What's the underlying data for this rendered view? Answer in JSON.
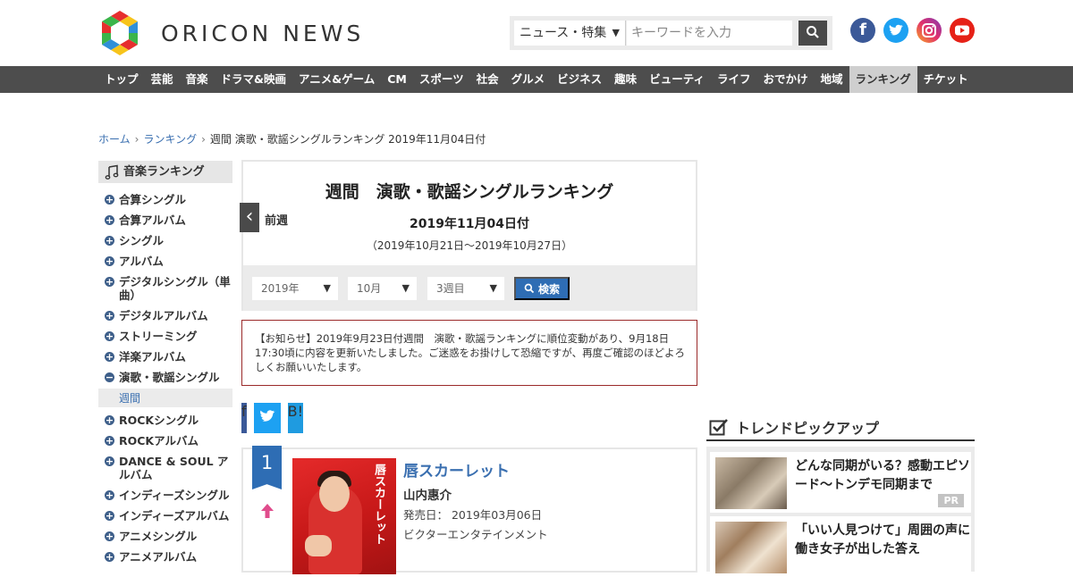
{
  "header": {
    "logo_text": "ORICON NEWS",
    "search": {
      "category": "ニュース・特集",
      "placeholder": "キーワードを入力"
    },
    "sns": [
      "facebook-icon",
      "twitter-icon",
      "instagram-icon",
      "youtube-icon"
    ]
  },
  "nav": {
    "items": [
      "トップ",
      "芸能",
      "音楽",
      "ドラマ&映画",
      "アニメ&ゲーム",
      "CM",
      "スポーツ",
      "社会",
      "グルメ",
      "ビジネス",
      "趣味",
      "ビューティ",
      "ライフ",
      "おでかけ",
      "地域",
      "ランキング",
      "チケット"
    ],
    "active": "ランキング"
  },
  "breadcrumb": {
    "home": "ホーム",
    "ranking": "ランキング",
    "current": "週間 演歌・歌謡シングルランキング 2019年11月04日付"
  },
  "sidebar": {
    "title": "音楽ランキング",
    "items": [
      {
        "label": "合算シングル",
        "mark": "+"
      },
      {
        "label": "合算アルバム",
        "mark": "+"
      },
      {
        "label": "シングル",
        "mark": "+"
      },
      {
        "label": "アルバム",
        "mark": "+"
      },
      {
        "label": "デジタルシングル（単曲）",
        "mark": "+"
      },
      {
        "label": "デジタルアルバム",
        "mark": "+"
      },
      {
        "label": "ストリーミング",
        "mark": "+"
      },
      {
        "label": "洋楽アルバム",
        "mark": "+"
      },
      {
        "label": "演歌・歌謡シングル",
        "mark": "−"
      },
      {
        "label": "週間",
        "mark": ""
      },
      {
        "label": "ROCKシングル",
        "mark": "+"
      },
      {
        "label": "ROCKアルバム",
        "mark": "+"
      },
      {
        "label": "DANCE & SOUL アルバム",
        "mark": "+"
      },
      {
        "label": "インディーズシングル",
        "mark": "+"
      },
      {
        "label": "インディーズアルバム",
        "mark": "+"
      },
      {
        "label": "アニメシングル",
        "mark": "+"
      },
      {
        "label": "アニメアルバム",
        "mark": "+"
      }
    ]
  },
  "ranking": {
    "title": "週間　演歌・歌謡シングルランキング",
    "prev_label": "前週",
    "date": "2019年11月04日付",
    "range": "（2019年10月21日～2019年10月27日）",
    "filters": {
      "year": "2019年",
      "month": "10月",
      "week": "3週目",
      "search_label": "検索"
    },
    "notice": "【お知らせ】2019年9月23日付週間　演歌・歌謡ランキングに順位変動があり、9月18日17:30頃に内容を更新いたしました。ご迷惑をお掛けして恐縮ですが、再度ご確認のほどよろしくお願いいたします。"
  },
  "share": {
    "facebook": "f",
    "twitter": "t",
    "hatena": "B!"
  },
  "entry": {
    "rank": "1",
    "trend_icon": "arrow-up-icon",
    "title": "唇スカーレット",
    "artist": "山内惠介",
    "release": "発売日：  2019年03月06日",
    "label": "ビクターエンタテインメント",
    "jacket_text": "唇スカーレット"
  },
  "trend": {
    "title": "トレンドピックアップ",
    "items": [
      {
        "text": "どんな同期がいる？感動エピソード～トンデモ同期まで",
        "badge": "PR"
      },
      {
        "text": "「いい人見つけて」周囲の声に働き女子が出した答え",
        "badge": ""
      }
    ]
  },
  "colors": {
    "accent": "#2e6db4",
    "nav_bg": "#4d4d4d",
    "notice_border": "#9b2a2a",
    "link": "#3a6fb0"
  }
}
